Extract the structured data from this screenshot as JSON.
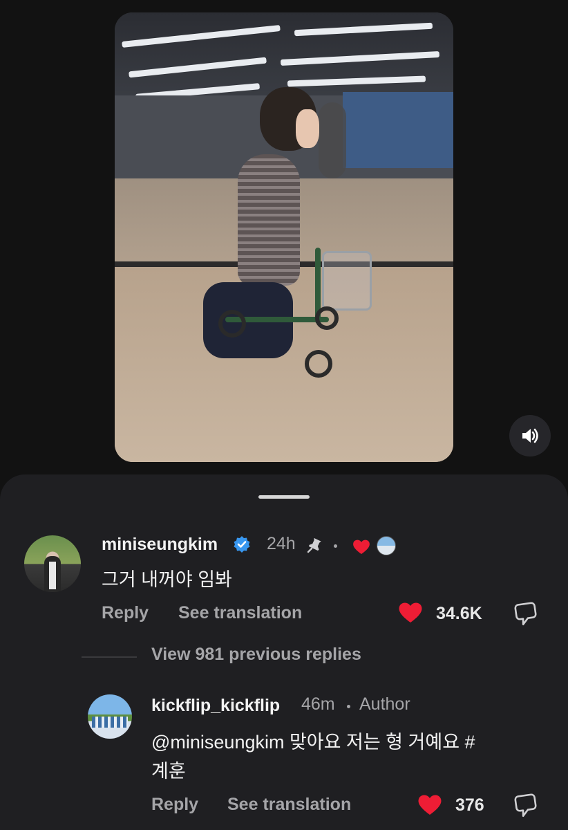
{
  "comments": [
    {
      "username": "miniseungkim",
      "time": "24h",
      "text": "그거 내꺼야 임봐",
      "reply_label": "Reply",
      "translate_label": "See translation",
      "likes": "34.6K",
      "verified": true,
      "pinned": true,
      "liked_by_author": true
    },
    {
      "username": "kickflip_kickflip",
      "time": "46m",
      "badge": "Author",
      "text_line1": "@miniseungkim 맞아요 저는 형 거예요 #",
      "text_line2": "계훈",
      "reply_label": "Reply",
      "translate_label": "See translation",
      "likes": "376"
    }
  ],
  "thread": {
    "view_replies_label": "View 981 previous replies"
  },
  "colors": {
    "background": "#121212",
    "sheet": "#1f1f22",
    "like_red": "#ee1d35",
    "verified_blue": "#3897f0",
    "muted_text": "#a5a5a8"
  },
  "icons": [
    "speaker-icon",
    "verified-badge-icon",
    "pin-icon",
    "heart-icon",
    "reply-icon"
  ]
}
